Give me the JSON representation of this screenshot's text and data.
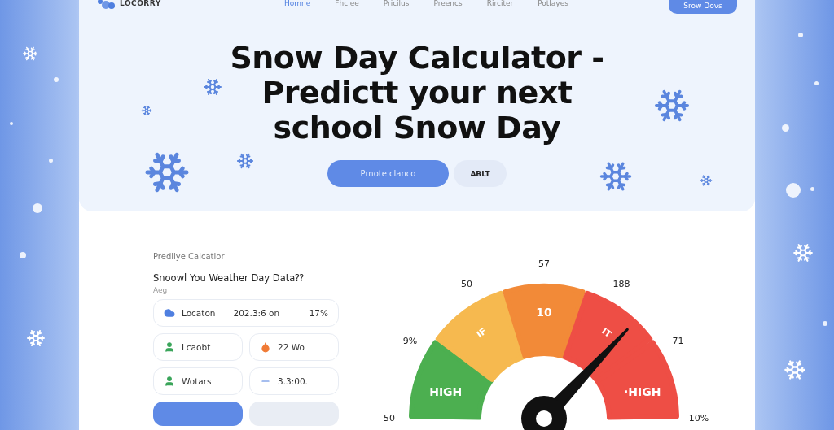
{
  "brand": {
    "name": "LOCORRY"
  },
  "nav": [
    {
      "label": "Homne",
      "selected": true
    },
    {
      "label": "Fhciee",
      "selected": false
    },
    {
      "label": "Pricilus",
      "selected": false
    },
    {
      "label": "Preencs",
      "selected": false
    },
    {
      "label": "Rirciter",
      "selected": false
    },
    {
      "label": "Potlayes",
      "selected": false
    }
  ],
  "nav_button": "Srow Dovs",
  "hero": {
    "title_lines": [
      "Snow Day Calculator -",
      "Predictt your next",
      "school Snow Day"
    ],
    "primary_button": "Prnote clanco",
    "secondary_button": "ABLT"
  },
  "calculator": {
    "eyebrow": "Prediiye Calcatior",
    "heading": "Snoowl You Weather Day Data⁇",
    "subheading": "Aeg",
    "fields": [
      {
        "kind": "wide",
        "label": "Locaton",
        "value": "202.3:6 on",
        "extra": "17%"
      },
      {
        "kind": "half",
        "label": "Lcaobt"
      },
      {
        "kind": "half",
        "label": "22 Wo"
      },
      {
        "kind": "half",
        "label": "Wotars"
      },
      {
        "kind": "half",
        "label": "3.3:00."
      }
    ]
  },
  "gauge": {
    "segments": [
      {
        "label": "HIGH",
        "color": "#4caf50"
      },
      {
        "label": "IF",
        "color": "#f6b94f"
      },
      {
        "label": "10",
        "color": "#f28a38"
      },
      {
        "label": "IT",
        "color": "#ee4e45"
      },
      {
        "label": "·HIGH",
        "color": "#ee4e45"
      }
    ],
    "scale_labels": [
      "50",
      "9%",
      "50",
      "57",
      "188",
      "71",
      "10%"
    ]
  }
}
